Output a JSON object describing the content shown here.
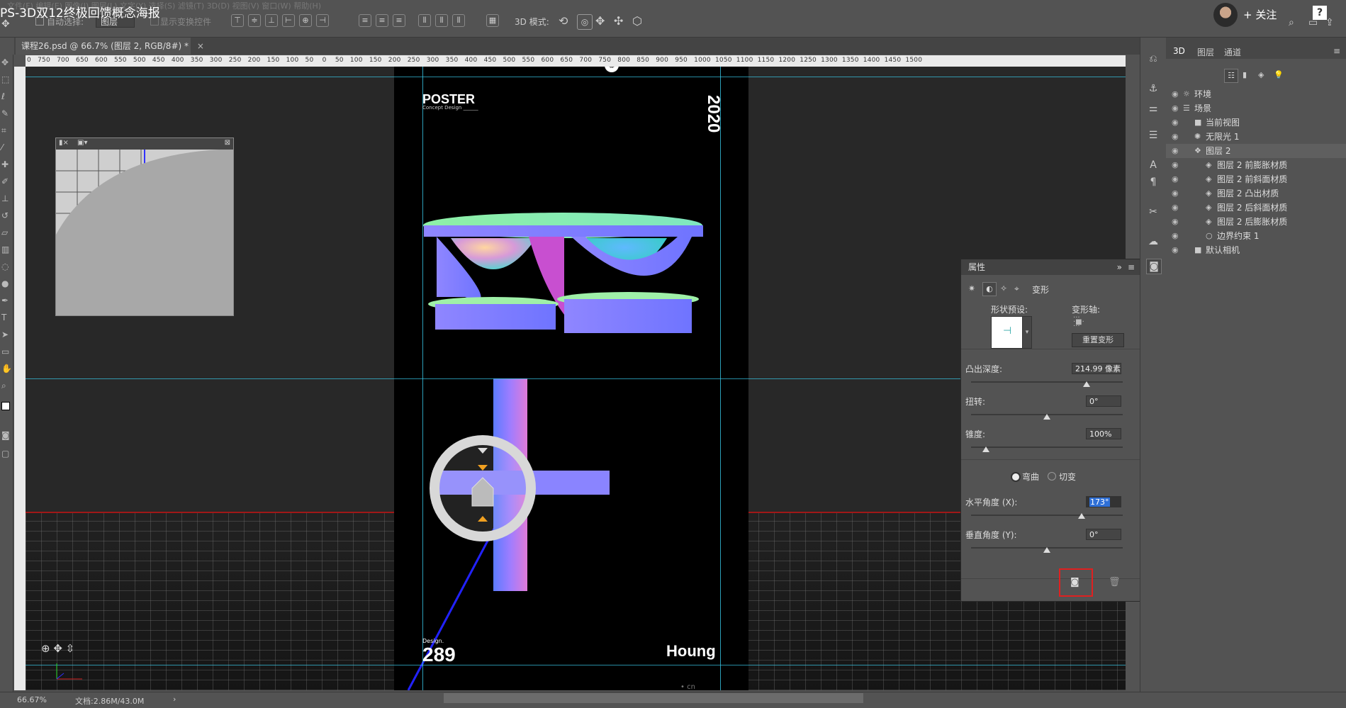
{
  "video_title": "PS-3D双12终极回馈概念海报",
  "menubar_faded": "文件(F)  编辑(E)  图像(I)  图层(L)  文字(Y)  选择(S)  滤镜(T)  3D(D)  视图(V)  窗口(W)  帮助(H)",
  "options_bar": {
    "auto_select_label": "自动选择:",
    "auto_select_value": "图层",
    "show_transform": "显示变换控件",
    "mode_3d_label": "3D 模式:"
  },
  "follow_button": "+ 关注",
  "help_button": "?",
  "document_tab": "课程26.psd @ 66.7% (图层 2, RGB/8#) *",
  "ruler_ticks": "0   750   700   650   600   550   500   450   400   350   300   250   200   150   100   50    0    50   100   150   200   250   300   350   400   450   500   550   600   650   700   750   800   850   900   950   1000  1050  1100  1150  1200  1250  1300  1350  1400  1450  1500",
  "poster": {
    "title": "POSTER",
    "subtitle": "Concept Design ______",
    "year": "2020",
    "design_label": "Design.",
    "design_number": "289",
    "brand": "Houng"
  },
  "watermark": "• cn",
  "properties": {
    "header": "属性",
    "section": "变形",
    "shape_preset_label": "形状预设:",
    "deform_axis_label": "变形轴:",
    "reset_button": "重置变形",
    "extrusion_label": "凸出深度:",
    "extrusion_value": "214.99 像素",
    "extrusion_pos": 0.76,
    "twist_label": "扭转:",
    "twist_value": "0°",
    "twist_pos": 0.5,
    "taper_label": "锥度:",
    "taper_value": "100%",
    "taper_pos": 0.1,
    "bend_label": "弯曲",
    "shear_label": "切变",
    "h_angle_label": "水平角度 (X):",
    "h_angle_value": "173°",
    "h_angle_pos": 0.73,
    "v_angle_label": "垂直角度 (Y):",
    "v_angle_value": "0°",
    "v_angle_pos": 0.5
  },
  "panel3d": {
    "tabs": [
      "3D",
      "图层",
      "通道"
    ],
    "rows": [
      {
        "label": "环境",
        "indent": 0,
        "icon": "☼"
      },
      {
        "label": "场景",
        "indent": 0,
        "icon": "☰"
      },
      {
        "label": "当前视图",
        "indent": 1,
        "icon": "■"
      },
      {
        "label": "无限光 1",
        "indent": 1,
        "icon": "✺"
      },
      {
        "label": "图层 2",
        "indent": 1,
        "icon": "❖"
      },
      {
        "label": "图层 2 前膨胀材质",
        "indent": 2,
        "icon": "◈"
      },
      {
        "label": "图层 2 前斜面材质",
        "indent": 2,
        "icon": "◈"
      },
      {
        "label": "图层 2 凸出材质",
        "indent": 2,
        "icon": "◈"
      },
      {
        "label": "图层 2 后斜面材质",
        "indent": 2,
        "icon": "◈"
      },
      {
        "label": "图层 2 后膨胀材质",
        "indent": 2,
        "icon": "◈"
      },
      {
        "label": "边界约束 1",
        "indent": 2,
        "icon": "○"
      },
      {
        "label": "默认相机",
        "indent": 1,
        "icon": "■"
      }
    ]
  },
  "status": {
    "zoom": "66.67%",
    "doc": "文档:2.86M/43.0M"
  },
  "colors": {
    "ui_bg": "#535353",
    "accent_guide": "#37c6e6",
    "highlight": "#e02020"
  }
}
